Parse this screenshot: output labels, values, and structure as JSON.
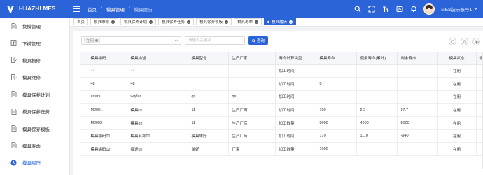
{
  "app": {
    "logo_text": "HUAZHI MES"
  },
  "breadcrumb": {
    "home": "首页",
    "section": "模具管理",
    "current": "模具履历",
    "sep": "/"
  },
  "topbar": {
    "username": "MES演示账号1",
    "icons": [
      "search-icon",
      "fullscreen-icon",
      "font-size-icon",
      "translate-icon",
      "bell-icon"
    ]
  },
  "sidebar": {
    "items": [
      {
        "label": "换模管理",
        "icon": "doc-icon"
      },
      {
        "label": "下模管理",
        "icon": "doc-icon"
      },
      {
        "label": "模具报修",
        "icon": "edit-doc-icon"
      },
      {
        "label": "模具维修",
        "icon": "edit-doc-icon"
      },
      {
        "label": "模具保养计划",
        "icon": "doc-icon"
      },
      {
        "label": "模具保养任务",
        "icon": "doc-icon"
      },
      {
        "label": "模具保养模板",
        "icon": "doc-icon"
      },
      {
        "label": "模具寿命",
        "icon": "doc-icon"
      },
      {
        "label": "模具履历",
        "icon": "history-icon"
      }
    ],
    "active_index": 8
  },
  "tabs": [
    {
      "label": "首页"
    },
    {
      "label": "模具维修"
    },
    {
      "label": "模具保养计划"
    },
    {
      "label": "模具保养任务"
    },
    {
      "label": "模具保养模板"
    },
    {
      "label": "模具寿命"
    },
    {
      "label": "模具履历"
    }
  ],
  "active_tab_index": 6,
  "filter": {
    "status_chip": "在用",
    "keyword_placeholder": "请输入关键字",
    "query_label": "查询"
  },
  "table": {
    "columns": [
      "",
      "模具编码",
      "模具描述",
      "模具型号",
      "生产厂家",
      "寿命计算类型",
      "模具寿命",
      "使用寿命(累计)",
      "剩余寿命",
      "模具状态",
      "使"
    ],
    "rows": [
      [
        "",
        "12",
        "12",
        "",
        "",
        "加工时间",
        "",
        "",
        "",
        "在用",
        ""
      ],
      [
        "",
        "48",
        "48",
        "",
        "",
        "加工时间",
        "0",
        "",
        "",
        "在用",
        ""
      ],
      [
        "",
        "asszs",
        "wqdas",
        "qs",
        "qs",
        "加工时间",
        "",
        "",
        "",
        "在用",
        ""
      ],
      [
        "",
        "MJ001",
        "模具01",
        "11",
        "生产厂商",
        "加工时间",
        "100",
        "2.3",
        "97.7",
        "在用",
        ""
      ],
      [
        "",
        "MJ002",
        "模具02",
        "11",
        "生产厂商",
        "加工数量",
        "9000",
        "4000",
        "5000",
        "在用",
        ""
      ],
      [
        "",
        "模具编码01",
        "模具名称01",
        "模具单好",
        "生产厂商",
        "加工时间",
        "170",
        "1110",
        "-940",
        "在用",
        ""
      ],
      [
        "",
        "模具编码02",
        "描述02",
        "单好",
        "厂家",
        "加工数量",
        "1000",
        "",
        "",
        "在用",
        ""
      ]
    ]
  },
  "colors": {
    "primary": "#2b64d8",
    "header_bg": "#f5f7fa"
  }
}
